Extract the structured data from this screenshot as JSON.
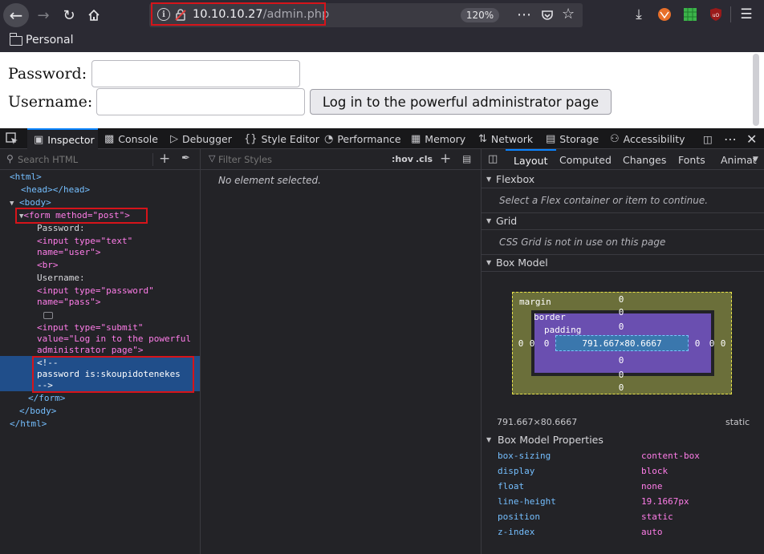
{
  "browser": {
    "url_host": "10.10.10.27",
    "url_path": "/admin.php",
    "zoom": "120%",
    "bookmark_folder": "Personal"
  },
  "page": {
    "password_label": "Password:",
    "username_label": "Username:",
    "password_value": "",
    "username_value": "",
    "submit_label": "Log in to the powerful administrator page"
  },
  "devtools": {
    "tabs": [
      "Inspector",
      "Console",
      "Debugger",
      "Style Editor",
      "Performance",
      "Memory",
      "Network",
      "Storage",
      "Accessibility"
    ],
    "search_placeholder": "Search HTML",
    "filter_placeholder": "Filter Styles",
    "hov": ":hov",
    "cls": ".cls",
    "no_selection": "No element selected.",
    "layout_tabs": [
      "Layout",
      "Computed",
      "Changes",
      "Fonts",
      "Animat"
    ],
    "html_lines": {
      "html_open": "<html>",
      "head": "<head></head>",
      "body_open": "<body>",
      "form_open": "<form method=\"post\">",
      "password_text": "Password:",
      "input1_a": "<input type=\"text\"",
      "input1_b": "name=\"user\">",
      "br": "<br>",
      "username_text": "Username:",
      "input2_a": "<input type=\"password\"",
      "input2_b": "name=\"pass\">",
      "input3_a": "<input type=\"submit\"",
      "input3_b": "value=\"Log in to the powerful",
      "input3_c": "administrator page\">",
      "comment_a": "<!--",
      "comment_b": "password is:skoupidotenekes",
      "comment_c": "-->",
      "form_close": "</form>",
      "body_close": "</body>",
      "html_close": "</html>"
    },
    "flexbox": {
      "title": "Flexbox",
      "message": "Select a Flex container or item to continue."
    },
    "grid": {
      "title": "Grid",
      "message": "CSS Grid is not in use on this page"
    },
    "box_model": {
      "title": "Box Model",
      "margin_label": "margin",
      "border_label": "border",
      "padding_label": "padding",
      "content_size": "791.667×80.6667",
      "zero": "0",
      "dimensions": "791.667×80.6667",
      "position": "static"
    },
    "box_model_properties": {
      "title": "Box Model Properties",
      "items": [
        {
          "name": "box-sizing",
          "value": "content-box"
        },
        {
          "name": "display",
          "value": "block"
        },
        {
          "name": "float",
          "value": "none"
        },
        {
          "name": "line-height",
          "value": "19.1667px"
        },
        {
          "name": "position",
          "value": "static"
        },
        {
          "name": "z-index",
          "value": "auto"
        }
      ]
    }
  },
  "colors": {
    "highlight_red": "#d6141a",
    "selection_blue": "#204e8a",
    "accent": "#0a84ff"
  }
}
